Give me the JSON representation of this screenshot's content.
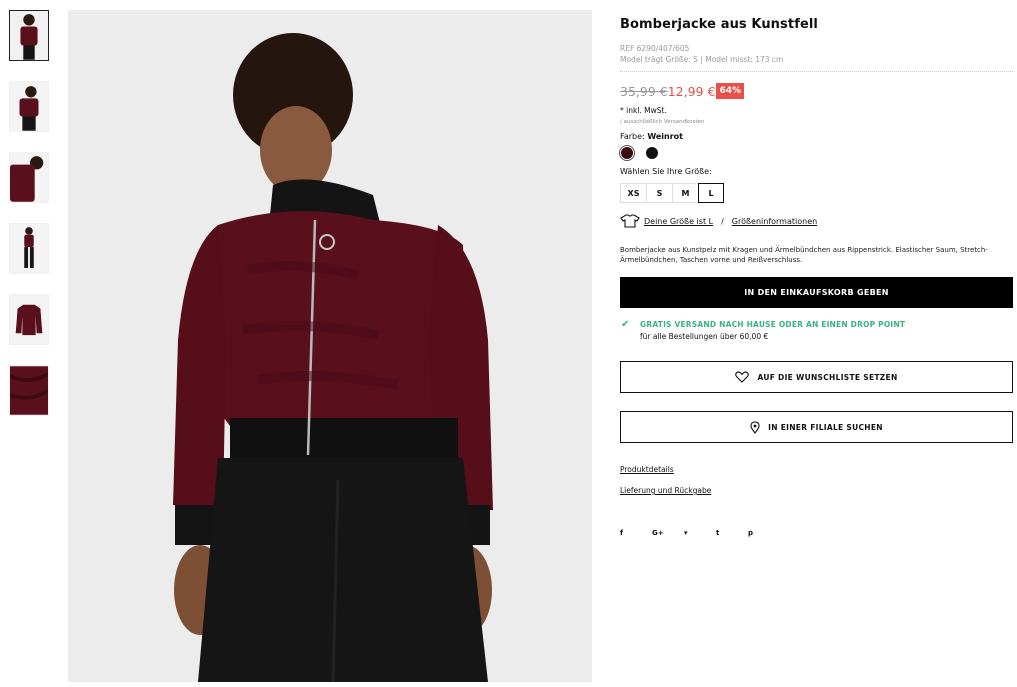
{
  "product": {
    "title": "Bomberjacke aus Kunstfell",
    "ref": "REF 6290/407/605",
    "model_info": "Model trägt Größe: S | Model misst: 173 cm",
    "old_price": "35,99 €",
    "new_price": "12,99 €",
    "discount": "64%",
    "tax": "* inkl. MwSt.",
    "shipping_note": "/ ausschließlich Versandkosten",
    "color_label": "Farbe:",
    "color_value": "Weinrot",
    "colors": [
      "#3d0a12",
      "#111111"
    ],
    "size_title": "Wählen Sie Ihre Größe:",
    "sizes": [
      "XS",
      "S",
      "M",
      "L"
    ],
    "selected_size": "L",
    "your_size": "Deine Größe ist L",
    "size_sep": "/",
    "size_info": "Größeninformationen",
    "description": "Bomberjacke aus Kunstpelz mit Kragen und Ärmelbündchen aus Rippenstrick. Elastischer Saum, Stretch-Ärmelbündchen, Taschen vorne und Reißverschluss."
  },
  "actions": {
    "add_to_cart": "IN DEN EINKAUFSKORB GEBEN",
    "shipping_title": "GRATIS VERSAND NACH HAUSE ODER AN EINEN DROP POINT",
    "shipping_sub": "für alle Bestellungen über 60,00 €",
    "wishlist": "AUF DIE WUNSCHLISTE SETZEN",
    "find_store": "IN EINER FILIALE SUCHEN",
    "product_details": "Produktdetails",
    "delivery": "Lieferung und Rückgabe"
  },
  "social": [
    "f",
    "G+",
    "t",
    "t",
    "p"
  ],
  "colors": {
    "accent_red": "#e8504a",
    "accent_green": "#39b37c",
    "jacket": "#5a0f1c"
  }
}
